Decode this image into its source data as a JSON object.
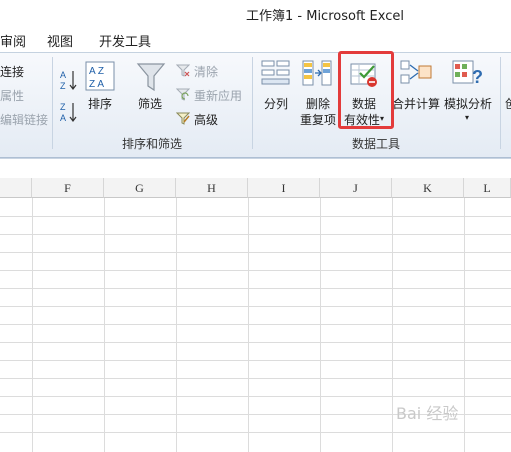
{
  "window": {
    "title": "工作簿1 - Microsoft Excel"
  },
  "tabs": [
    {
      "label": "审阅"
    },
    {
      "label": "视图"
    },
    {
      "label": "开发工具"
    }
  ],
  "ribbon": {
    "connections": {
      "items": [
        "连接",
        "属性",
        "编辑链接"
      ]
    },
    "sort_filter": {
      "label": "排序和筛选",
      "sort": "排序",
      "filter": "筛选",
      "clear": "清除",
      "reapply": "重新应用",
      "advanced": "高级"
    },
    "data_tools": {
      "label": "数据工具",
      "text_to_columns": "分列",
      "remove_duplicates_1": "删除",
      "remove_duplicates_2": "重复项",
      "data_validation_1": "数据",
      "data_validation_2": "有效性",
      "consolidate": "合并计算",
      "what_if": "模拟分析"
    }
  },
  "sheet": {
    "columns": [
      "F",
      "G",
      "H",
      "I",
      "J",
      "K",
      "L"
    ]
  },
  "watermark": "Bai 经验",
  "colors": {
    "highlight": "#e33b3b",
    "ribbon_bg": "#e4ebf4"
  }
}
